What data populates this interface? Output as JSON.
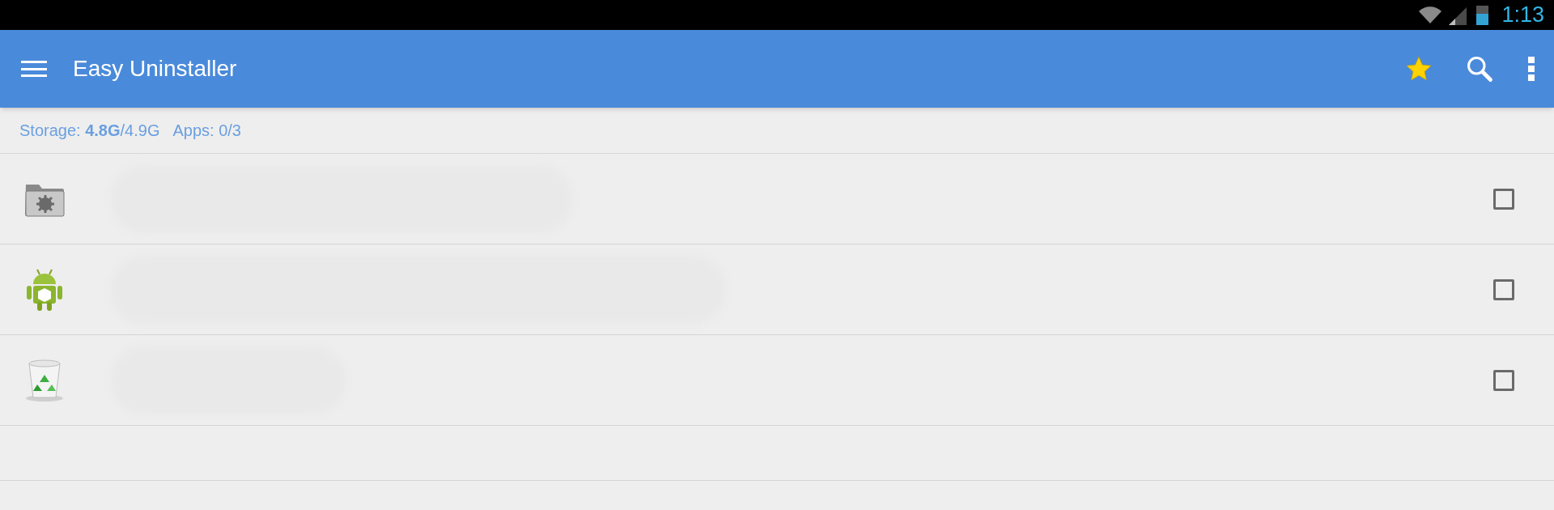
{
  "status_bar": {
    "time": "1:13"
  },
  "app_bar": {
    "title": "Easy Uninstaller"
  },
  "info": {
    "storage": "Storage: **4.8G**/4.9G",
    "apps": "Apps: 0/3"
  },
  "apps": [
    {
      "kind": "folder",
      "checked": false
    },
    {
      "kind": "android",
      "checked": false
    },
    {
      "kind": "trash",
      "checked": false
    }
  ]
}
